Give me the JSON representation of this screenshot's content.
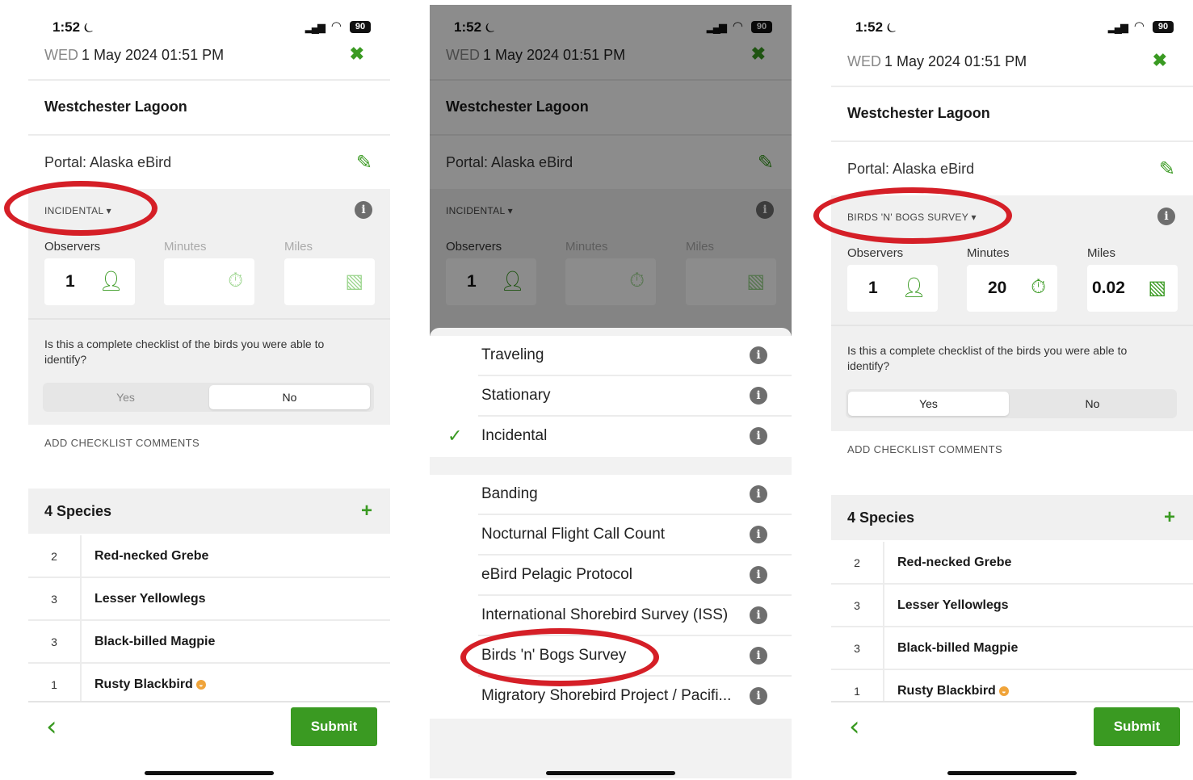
{
  "status": {
    "time": "1:52",
    "moon": "⏾",
    "battery": "90"
  },
  "header": {
    "day": "WED",
    "datetime": "1 May 2024 01:51 PM",
    "close_icon": "✖"
  },
  "location": "Westchester Lagoon",
  "portal": "Portal: Alaska eBird",
  "protocols": {
    "incidental": "INCIDENTAL ▾",
    "birds_bogs": "BIRDS 'N' BOGS SURVEY ▾"
  },
  "fields": {
    "observers_label": "Observers",
    "minutes_label": "Minutes",
    "miles_label": "Miles",
    "observers": "1",
    "minutes": "20",
    "miles": "0.02"
  },
  "question": "Is this a complete checklist of the birds you were able to identify?",
  "yes_label": "Yes",
  "no_label": "No",
  "comments_label": "ADD CHECKLIST COMMENTS",
  "species_header": "4 Species",
  "species": [
    {
      "count": "2",
      "name": "Red-necked Grebe"
    },
    {
      "count": "3",
      "name": "Lesser Yellowlegs"
    },
    {
      "count": "3",
      "name": "Black-billed Magpie"
    },
    {
      "count": "1",
      "name": "Rusty Blackbird"
    }
  ],
  "submit_label": "Submit",
  "menu": {
    "group1": [
      "Traveling",
      "Stationary",
      "Incidental"
    ],
    "group2": [
      "Banding",
      "Nocturnal Flight Call Count",
      "eBird Pelagic Protocol",
      "International Shorebird Survey (ISS)",
      "Birds 'n' Bogs Survey",
      "Migratory Shorebird Project / Pacifi..."
    ]
  },
  "colors": {
    "accent_green": "#3a9a22",
    "highlight_red": "#d51f27"
  }
}
